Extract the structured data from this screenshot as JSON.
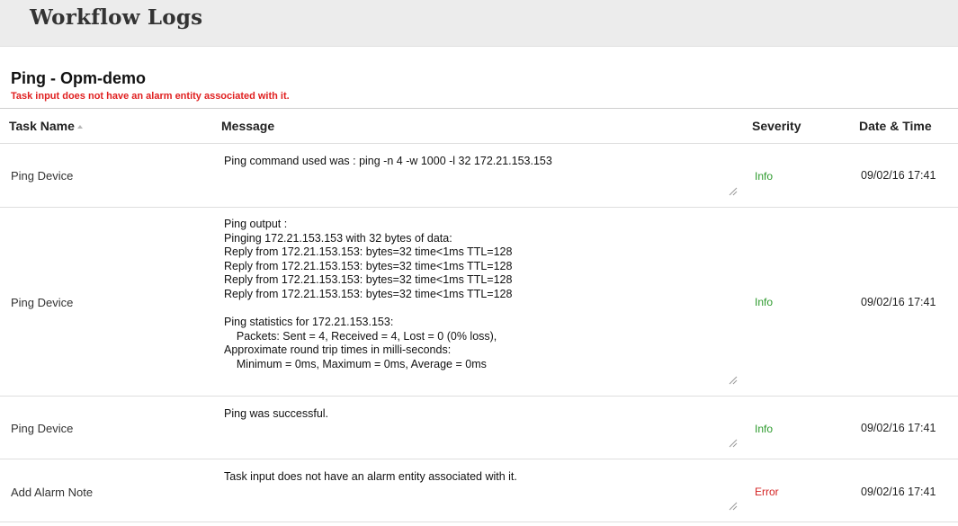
{
  "header": {
    "title": "Workflow Logs"
  },
  "workflow": {
    "name": "Ping - Opm-demo",
    "error": "Task input does not have an alarm entity associated with it."
  },
  "table": {
    "columns": {
      "task_name": "Task Name",
      "message": "Message",
      "severity": "Severity",
      "date_time": "Date & Time"
    },
    "rows": [
      {
        "task": "Ping Device",
        "message": "Ping command used was : ping -n 4 -w 1000 -l 32 172.21.153.153",
        "severity": "Info",
        "date": "09/02/16 17:41"
      },
      {
        "task": "Ping Device",
        "message": "Ping output :\nPinging 172.21.153.153 with 32 bytes of data:\nReply from 172.21.153.153: bytes=32 time<1ms TTL=128\nReply from 172.21.153.153: bytes=32 time<1ms TTL=128\nReply from 172.21.153.153: bytes=32 time<1ms TTL=128\nReply from 172.21.153.153: bytes=32 time<1ms TTL=128\n\nPing statistics for 172.21.153.153:\n    Packets: Sent = 4, Received = 4, Lost = 0 (0% loss),\nApproximate round trip times in milli-seconds:\n    Minimum = 0ms, Maximum = 0ms, Average = 0ms",
        "severity": "Info",
        "date": "09/02/16 17:41"
      },
      {
        "task": "Ping Device",
        "message": "Ping was successful.",
        "severity": "Info",
        "date": "09/02/16 17:41"
      },
      {
        "task": "Add Alarm Note",
        "message": "Task input does not have an alarm entity associated with it.",
        "severity": "Error",
        "date": "09/02/16 17:41"
      }
    ]
  },
  "colors": {
    "info": "#2c9a2c",
    "error": "#d42424",
    "header_bg": "#ececec"
  }
}
